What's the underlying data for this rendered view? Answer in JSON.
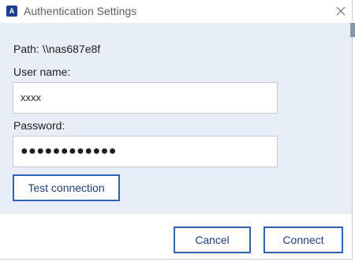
{
  "window": {
    "title": "Authentication Settings",
    "app_icon_letter": "A"
  },
  "form": {
    "path_label": "Path:",
    "path_value": "\\\\nas687e8f",
    "username_label": "User name:",
    "username_value": "xxxx",
    "password_label": "Password:",
    "password_value": "●●●●●●●●●●●●",
    "test_button": "Test connection"
  },
  "footer": {
    "cancel_button": "Cancel",
    "connect_button": "Connect"
  },
  "colors": {
    "accent": "#2f62b3",
    "body_bg": "#e9edf6",
    "icon_bg": "#1b3f8f"
  }
}
